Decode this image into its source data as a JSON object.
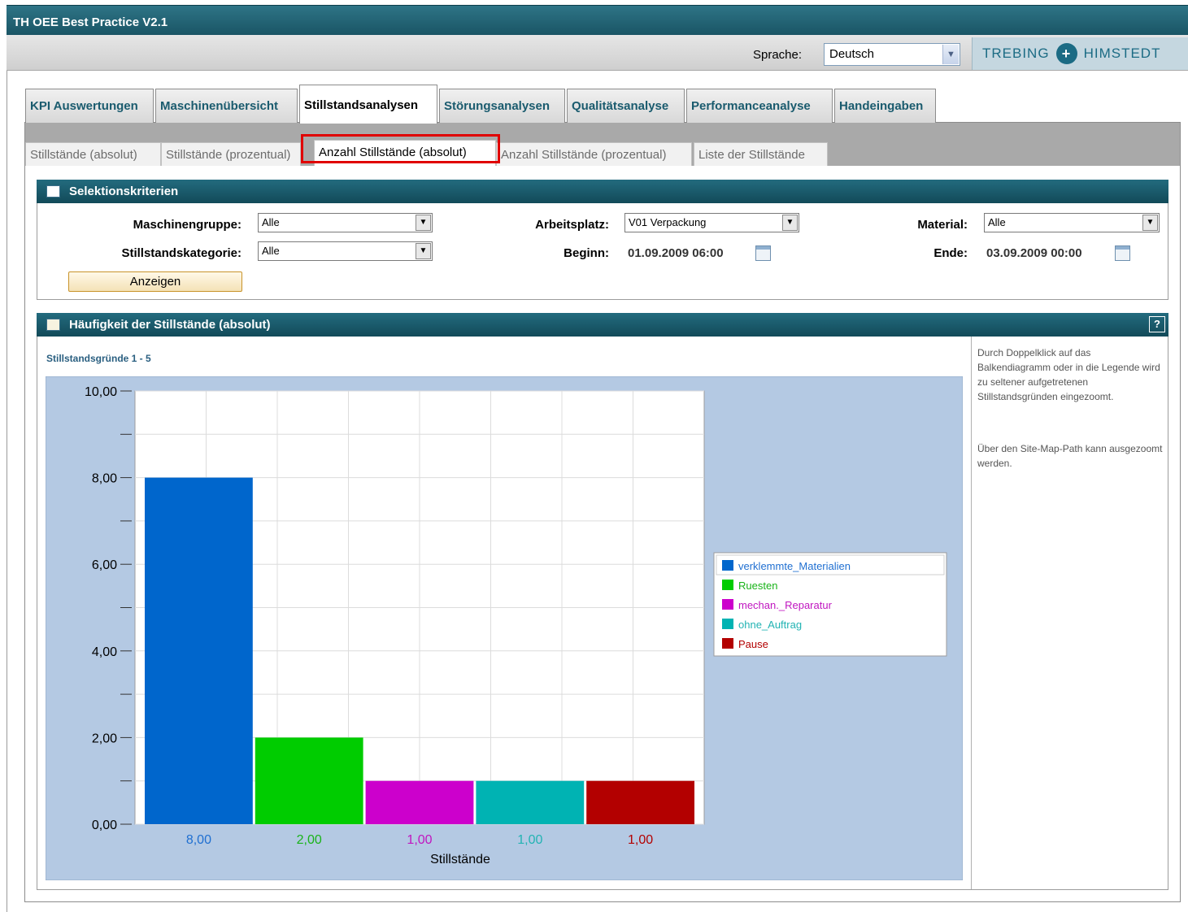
{
  "app": {
    "title": "TH OEE Best Practice V2.1"
  },
  "language": {
    "label": "Sprache:",
    "selected": "Deutsch"
  },
  "brand": {
    "left": "TREBING",
    "right": "HIMSTEDT"
  },
  "main_tabs": [
    {
      "label": "KPI Auswertungen",
      "active": false
    },
    {
      "label": "Maschinenübersicht",
      "active": false
    },
    {
      "label": "Stillstandsanalysen",
      "active": true
    },
    {
      "label": "Störungsanalysen",
      "active": false
    },
    {
      "label": "Qualitätsanalyse",
      "active": false
    },
    {
      "label": "Performanceanalyse",
      "active": false
    },
    {
      "label": "Handeingaben",
      "active": false
    }
  ],
  "sub_tabs": [
    {
      "label": "Stillstände (absolut)",
      "active": false
    },
    {
      "label": "Stillstände (prozentual)",
      "active": false
    },
    {
      "label": "Anzahl Stillstände (absolut)",
      "active": true
    },
    {
      "label": "Anzahl Stillstände (prozentual)",
      "active": false
    },
    {
      "label": "Liste der Stillstände",
      "active": false
    }
  ],
  "selection": {
    "title": "Selektionskriterien",
    "machine_group": {
      "label": "Maschinengruppe:",
      "value": "Alle"
    },
    "category": {
      "label": "Stillstandskategorie:",
      "value": "Alle"
    },
    "workplace": {
      "label": "Arbeitsplatz:",
      "value": "V01 Verpackung"
    },
    "begin": {
      "label": "Beginn:",
      "value": "01.09.2009 06:00"
    },
    "material": {
      "label": "Material:",
      "value": "Alle"
    },
    "end": {
      "label": "Ende:",
      "value": "03.09.2009 00:00"
    },
    "show_button": "Anzeigen"
  },
  "chart_panel": {
    "title": "Häufigkeit der Stillstände (absolut)",
    "help": "?",
    "subtitle": "Stillstandsgründe 1 - 5",
    "note1": "Durch Doppelklick auf das Balkendiagramm oder in die Legende wird zu seltener aufgetretenen Stillstandsgründen eingezoomt.",
    "note2": "Über den Site-Map-Path kann ausgezoomt werden."
  },
  "chart_data": {
    "type": "bar",
    "title": "",
    "xlabel": "Stillstände",
    "ylabel": "",
    "ylim": [
      0,
      10
    ],
    "yticks": [
      "0,00",
      "2,00",
      "4,00",
      "6,00",
      "8,00",
      "10,00"
    ],
    "grid": true,
    "legend_position": "right",
    "categories": [
      "verklemmte_Materialien",
      "Ruesten",
      "mechan._Reparatur",
      "ohne_Auftrag",
      "Pause"
    ],
    "values": [
      8,
      2,
      1,
      1,
      1
    ],
    "value_labels": [
      "8,00",
      "2,00",
      "1,00",
      "1,00",
      "1,00"
    ],
    "colors": [
      "#0066cc",
      "#00cc00",
      "#cc00cc",
      "#00b3b3",
      "#b30000"
    ],
    "label_colors": [
      "#1f6fd1",
      "#19b319",
      "#c016c0",
      "#22b3b3",
      "#b30000"
    ]
  }
}
